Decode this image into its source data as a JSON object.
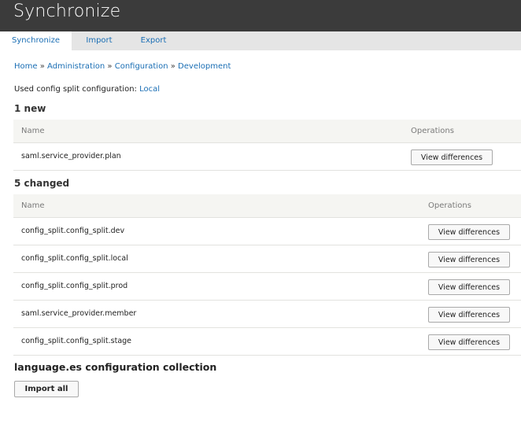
{
  "header": {
    "title": "Synchronize"
  },
  "tabs": [
    {
      "label": "Synchronize",
      "active": true
    },
    {
      "label": "Import",
      "active": false
    },
    {
      "label": "Export",
      "active": false
    }
  ],
  "breadcrumb": {
    "items": [
      "Home",
      "Administration",
      "Configuration",
      "Development"
    ],
    "separator": "»"
  },
  "used_config": {
    "label": "Used config split configuration:",
    "value": "Local"
  },
  "new_section": {
    "title": "1 new",
    "headers": {
      "name": "Name",
      "operations": "Operations"
    },
    "rows": [
      {
        "name": "saml.service_provider.plan",
        "action": "View differences"
      }
    ]
  },
  "changed_section": {
    "title": "5 changed",
    "headers": {
      "name": "Name",
      "operations": "Operations"
    },
    "rows": [
      {
        "name": "config_split.config_split.dev",
        "action": "View differences"
      },
      {
        "name": "config_split.config_split.local",
        "action": "View differences"
      },
      {
        "name": "config_split.config_split.prod",
        "action": "View differences"
      },
      {
        "name": "saml.service_provider.member",
        "action": "View differences"
      },
      {
        "name": "config_split.config_split.stage",
        "action": "View differences"
      }
    ]
  },
  "collection": {
    "title": "language.es configuration collection",
    "button": "Import all"
  },
  "colors": {
    "header_bg": "#3b3b3b",
    "link": "#1a6eb4",
    "tabbar_bg": "#e5e5e5",
    "table_head_bg": "#f5f5f2"
  }
}
